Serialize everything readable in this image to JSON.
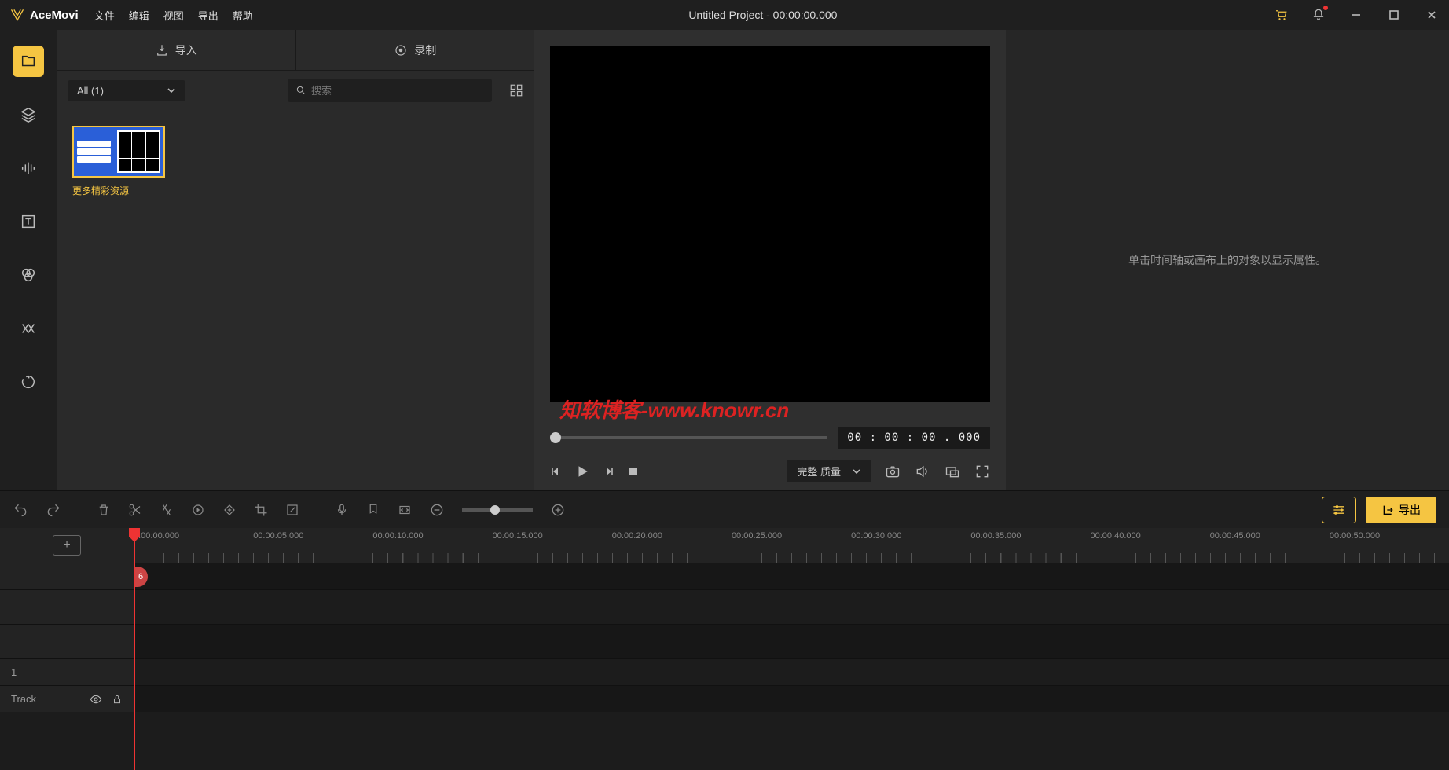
{
  "app": {
    "name": "AceMovi"
  },
  "titlebar": {
    "menu": [
      "文件",
      "编辑",
      "视图",
      "导出",
      "帮助"
    ],
    "title": "Untitled Project - 00:00:00.000"
  },
  "media": {
    "tabs": {
      "import": "导入",
      "record": "录制"
    },
    "filter": {
      "label": "All (1)"
    },
    "search": {
      "placeholder": "搜索"
    },
    "items": [
      {
        "label": "更多精彩资源"
      }
    ]
  },
  "preview": {
    "watermark": "知软博客-www.knowr.cn",
    "time": "00 : 00 : 00 . 000",
    "quality": "完整 质量"
  },
  "properties": {
    "hint": "单击时间轴或画布上的对象以显示属性。"
  },
  "toolbar": {
    "export": "导出"
  },
  "timeline": {
    "ruler": [
      "0:00:00.000",
      "00:00:05.000",
      "00:00:10.000",
      "00:00:15.000",
      "00:00:20.000",
      "00:00:25.000",
      "00:00:30.000",
      "00:00:35.000",
      "00:00:40.000",
      "00:00:45.000",
      "00:00:50.000"
    ],
    "track": {
      "num": "1",
      "label": "Track"
    },
    "clip_stub": "6"
  }
}
